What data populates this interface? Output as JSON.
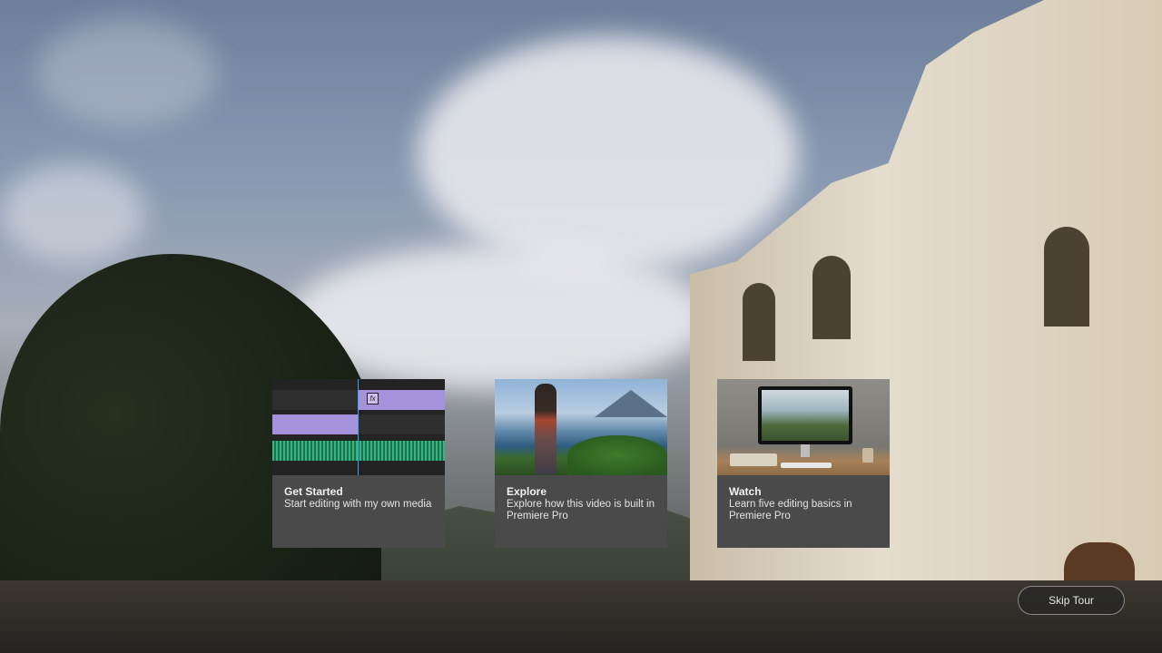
{
  "cards": [
    {
      "title": "Get Started",
      "description": "Start editing with my own media",
      "thumbnail_icon": "timeline-thumbnail"
    },
    {
      "title": "Explore",
      "description": "Explore how this video is built in Premiere Pro",
      "thumbnail_icon": "lake-landscape-thumbnail"
    },
    {
      "title": "Watch",
      "description": "Learn five editing basics in Premiere Pro",
      "thumbnail_icon": "desktop-computer-thumbnail"
    }
  ],
  "timeline": {
    "fx_badge": "fx"
  },
  "skip_tour": {
    "label": "Skip Tour"
  },
  "colors": {
    "card_background": "#4a4a4a",
    "clip_purple": "#a592dc",
    "audio_green": "#35b880",
    "playhead_blue": "#3fa7e6"
  }
}
